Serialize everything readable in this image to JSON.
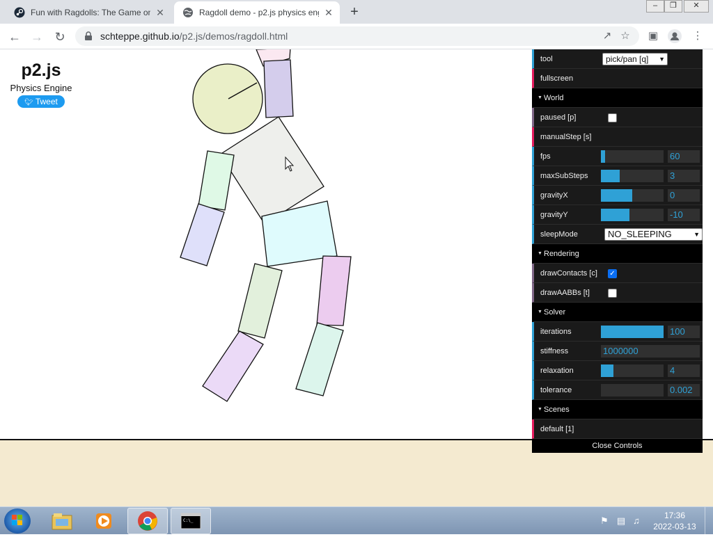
{
  "browser": {
    "tabs": [
      {
        "title": "Fun with Ragdolls: The Game on",
        "favicon": "steam-icon"
      },
      {
        "title": "Ragdoll demo - p2.js physics eng",
        "favicon": "globe-icon"
      }
    ],
    "url_host": "schteppe.github.io",
    "url_path": "/p2.js/demos/ragdoll.html",
    "controls": {
      "new_tab": "+",
      "close_tab": "✕"
    }
  },
  "page": {
    "logo_title": "p2.js",
    "logo_subtitle": "Physics Engine",
    "tweet_label": "Tweet"
  },
  "gui": {
    "tool_label": "tool",
    "tool_value": "pick/pan [q]",
    "fullscreen_label": "fullscreen",
    "world": {
      "folder_label": "World",
      "paused_label": "paused [p]",
      "paused": false,
      "manual_step_label": "manualStep [s]",
      "fps_label": "fps",
      "fps_value": "60",
      "max_sub_steps_label": "maxSubSteps",
      "max_sub_steps_value": "3",
      "gravity_x_label": "gravityX",
      "gravity_x_value": "0",
      "gravity_y_label": "gravityY",
      "gravity_y_value": "-10",
      "sleep_mode_label": "sleepMode",
      "sleep_mode_value": "NO_SLEEPING"
    },
    "rendering": {
      "folder_label": "Rendering",
      "draw_contacts_label": "drawContacts [c]",
      "draw_contacts": true,
      "draw_aabbs_label": "drawAABBs [t]",
      "draw_aabbs": false
    },
    "solver": {
      "folder_label": "Solver",
      "iterations_label": "iterations",
      "iterations_value": "100",
      "stiffness_label": "stiffness",
      "stiffness_value": "1000000",
      "relaxation_label": "relaxation",
      "relaxation_value": "4",
      "tolerance_label": "tolerance",
      "tolerance_value": "0.002"
    },
    "scenes": {
      "folder_label": "Scenes",
      "default_label": "default [1]"
    },
    "close_controls_label": "Close Controls",
    "slider_fill": {
      "fps": 0.07,
      "max_sub_steps": 0.3,
      "gravity_x": 0.5,
      "gravity_y": 0.45,
      "iterations": 1.0,
      "relaxation": 0.2,
      "tolerance": 0.0
    }
  },
  "taskbar": {
    "time": "17:36",
    "date": "2022-03-13",
    "apps": [
      "windows-explorer-icon",
      "media-player-icon",
      "chrome-icon",
      "command-prompt-icon"
    ]
  },
  "ragdoll_colors": {
    "head": "#eaefc8",
    "torso": "#eeefec",
    "pelvis": "#dffbfd",
    "upper_arm_left": "#dff9e6",
    "lower_arm_left": "#dfe0fa",
    "upper_arm_right": "#d4cdec",
    "lower_arm_right": "#fbe8f1",
    "upper_leg_left": "#e2f0dc",
    "lower_leg_left": "#ebdaf7",
    "upper_leg_right": "#ecccef",
    "lower_leg_right": "#dcf5ec"
  }
}
